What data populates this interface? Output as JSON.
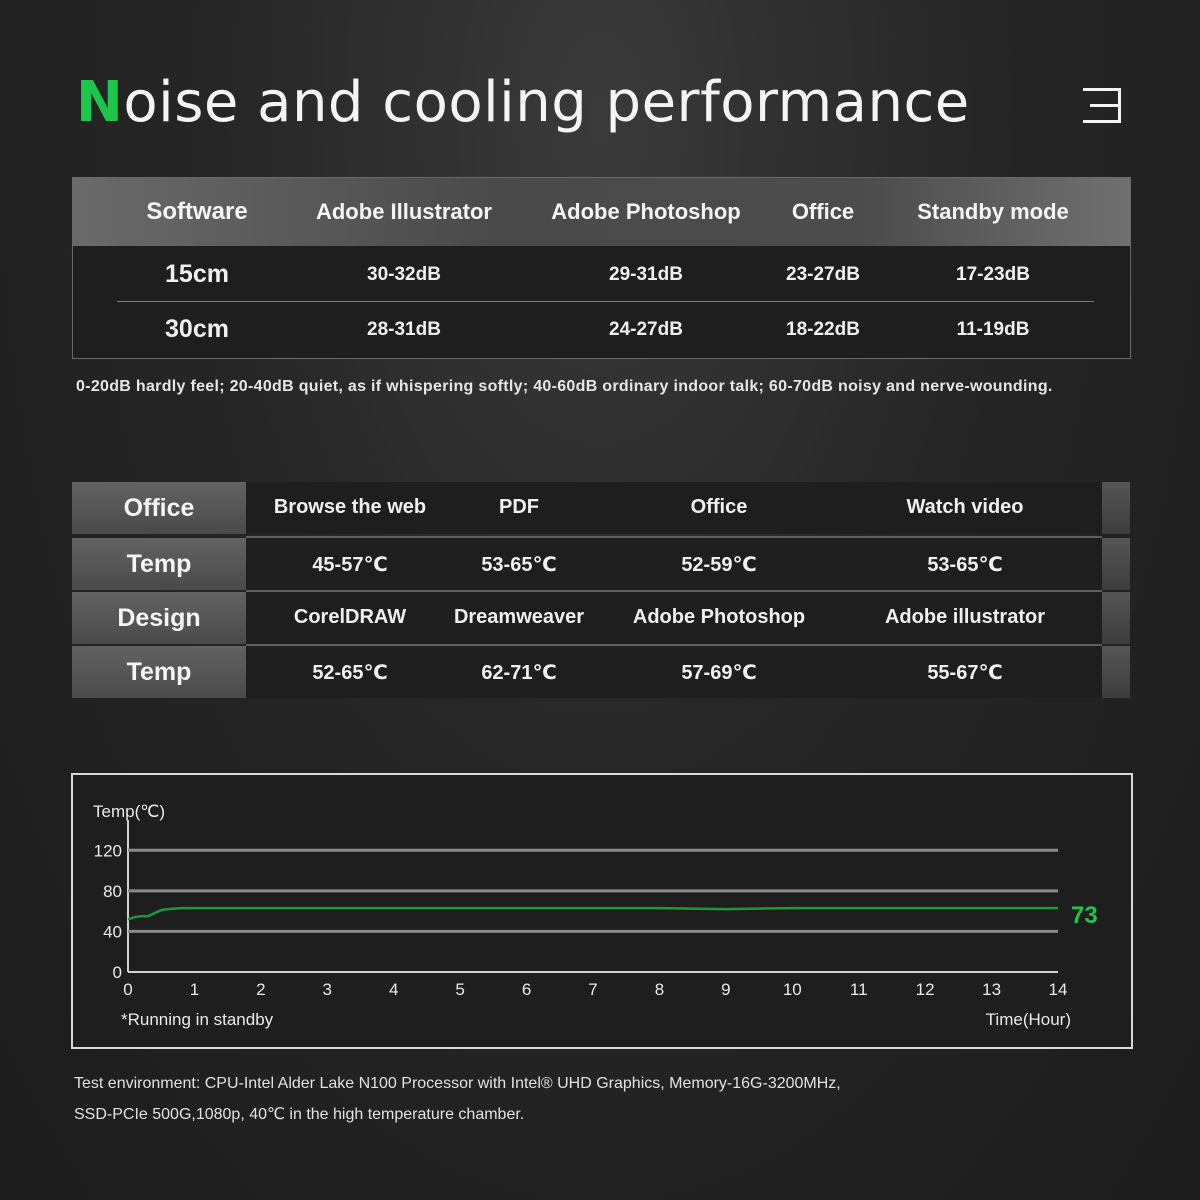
{
  "title": {
    "first_letter": "N",
    "rest": "oise and cooling performance"
  },
  "icons": {
    "logo": "three-bar-logo-icon"
  },
  "colors": {
    "accent": "#1fc44a",
    "line": "#1a9a3a",
    "background": "#262626"
  },
  "noise_table": {
    "header": [
      "Software",
      "Adobe Illustrator",
      "Adobe Photoshop",
      "Office",
      "Standby mode"
    ],
    "rows": [
      {
        "label": "15cm",
        "values": [
          "30-32dB",
          "29-31dB",
          "23-27dB",
          "17-23dB"
        ]
      },
      {
        "label": "30cm",
        "values": [
          "28-31dB",
          "24-27dB",
          "18-22dB",
          "11-19dB"
        ]
      }
    ],
    "note": "0-20dB hardly feel; 20-40dB quiet, as if whispering softly; 40-60dB ordinary indoor talk; 60-70dB noisy and nerve-wounding."
  },
  "temp_table": {
    "rows": [
      {
        "label": "Office",
        "values": [
          "Browse the web",
          "PDF",
          "Office",
          "Watch video"
        ]
      },
      {
        "label": "Temp",
        "values": [
          "45-57℃",
          "53-65℃",
          "52-59℃",
          "53-65℃"
        ]
      },
      {
        "label": "Design",
        "values": [
          "CorelDRAW",
          "Dreamweaver",
          "Adobe Photoshop",
          "Adobe illustrator"
        ]
      },
      {
        "label": "Temp",
        "values": [
          "52-65℃",
          "62-71℃",
          "57-69℃",
          "55-67℃"
        ]
      }
    ]
  },
  "chart_data": {
    "type": "line",
    "ylabel": "Temp(℃)",
    "xlabel": "Time(Hour)",
    "annotation": "*Running in standby",
    "end_label": "73",
    "ylim": [
      0,
      140
    ],
    "xlim": [
      0,
      14
    ],
    "yticks": [
      0,
      40,
      80,
      120
    ],
    "xticks": [
      0,
      1,
      2,
      3,
      4,
      5,
      6,
      7,
      8,
      9,
      10,
      11,
      12,
      13,
      14
    ],
    "grid": true,
    "series": [
      {
        "x": [
          0,
          0.1,
          0.2,
          0.3,
          0.4,
          0.5,
          0.6,
          0.8,
          1,
          2,
          4,
          6,
          8,
          9,
          10,
          12,
          14
        ],
        "y": [
          52,
          54,
          55,
          55,
          58,
          61,
          62,
          63,
          63,
          63,
          63,
          63,
          63,
          62,
          63,
          63,
          63
        ]
      }
    ]
  },
  "footnote": {
    "line1": "Test environment: CPU-Intel Alder Lake N100 Processor with Intel® UHD Graphics,  Memory-16G-3200MHz,",
    "line2": "SSD-PCIe 500G,1080p, 40℃ in the high temperature chamber."
  }
}
